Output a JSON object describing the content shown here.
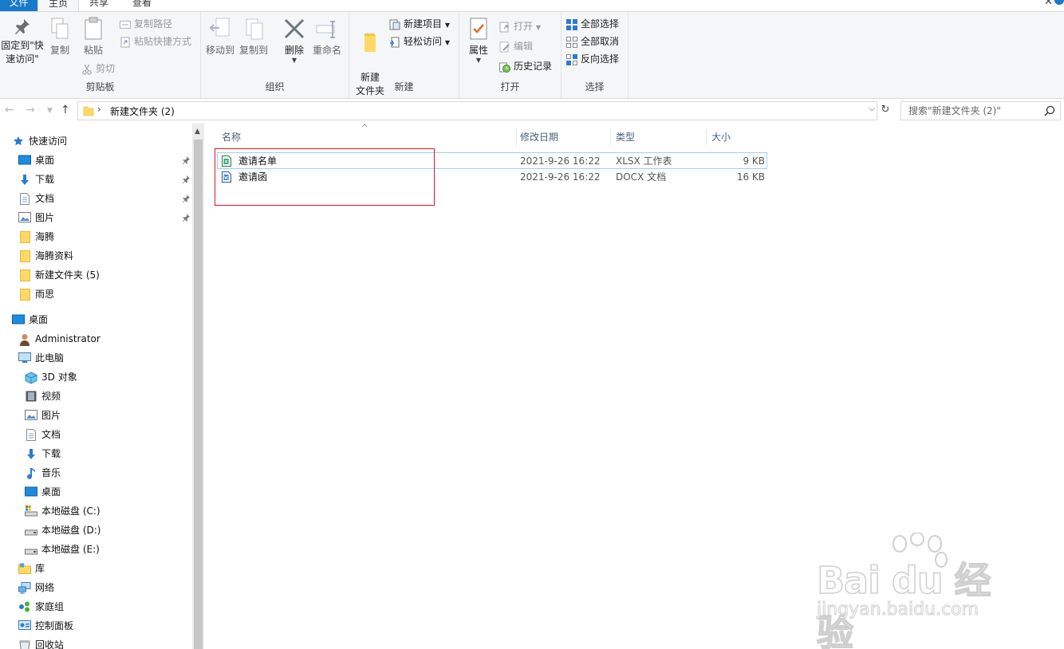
{
  "ribbon_tabs": {
    "file": "文件",
    "home": "主页",
    "share": "共享",
    "view": "查看"
  },
  "ribbon": {
    "clipboard": {
      "group_label": "剪贴板",
      "pin": "固定到\"快速访问\"",
      "copy": "复制",
      "paste": "粘贴",
      "copy_path": "复制路径",
      "paste_shortcut": "粘贴快捷方式",
      "cut": "剪切"
    },
    "organize": {
      "group_label": "组织",
      "move_to": "移动到",
      "copy_to": "复制到",
      "delete": "删除",
      "rename": "重命名"
    },
    "new": {
      "group_label": "新建",
      "new_folder": "新建\n文件夹",
      "new_item": "新建项目",
      "easy_access": "轻松访问"
    },
    "open": {
      "group_label": "打开",
      "properties": "属性",
      "open": "打开",
      "edit": "编辑",
      "history": "历史记录"
    },
    "select": {
      "group_label": "选择",
      "select_all": "全部选择",
      "select_none": "全部取消",
      "invert": "反向选择"
    }
  },
  "address": {
    "path": "新建文件夹 (2)",
    "search_placeholder": "搜索\"新建文件夹 (2)\""
  },
  "nav": {
    "quick_access": "快速访问",
    "quick_items": [
      "桌面",
      "下载",
      "文档",
      "图片",
      "海腾",
      "海腾资料",
      "新建文件夹 (5)",
      "雨思"
    ],
    "desktop": "桌面",
    "user": "Administrator",
    "this_pc": "此电脑",
    "pc_items": [
      "3D 对象",
      "视频",
      "图片",
      "文档",
      "下载",
      "音乐",
      "桌面",
      "本地磁盘 (C:)",
      "本地磁盘 (D:)",
      "本地磁盘 (E:)"
    ],
    "library": "库",
    "network": "网络",
    "homegroup": "家庭组",
    "control_panel": "控制面板",
    "recycle_bin": "回收站"
  },
  "columns": {
    "name": "名称",
    "modified": "修改日期",
    "type": "类型",
    "size": "大小"
  },
  "files": [
    {
      "name": "邀请名单",
      "modified": "2021-9-26 16:22",
      "type": "XLSX 工作表",
      "size": "9 KB",
      "kind": "xlsx"
    },
    {
      "name": "邀请函",
      "modified": "2021-9-26 16:22",
      "type": "DOCX 文档",
      "size": "16 KB",
      "kind": "docx"
    }
  ],
  "watermark": {
    "brand": "Bai du 经验",
    "url": "jingyan.baidu.com"
  },
  "colors": {
    "accent": "#1979ca",
    "highlight_box": "#e0161b",
    "selection_border": "#99d1ff"
  }
}
